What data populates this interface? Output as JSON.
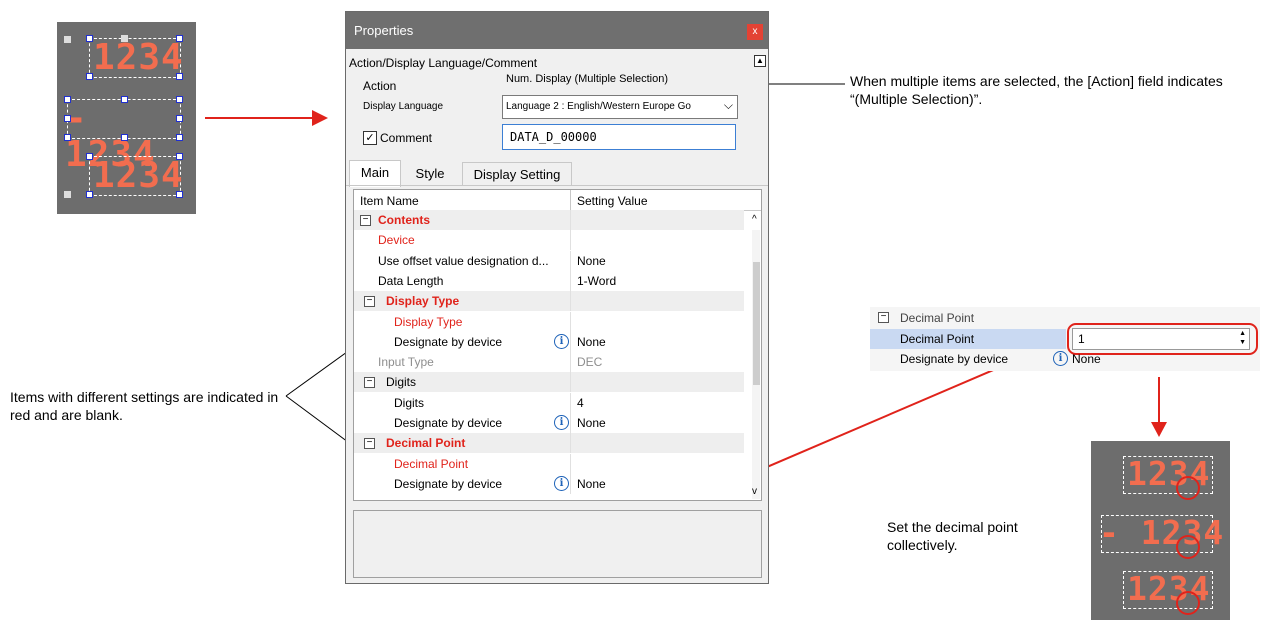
{
  "left_displays": [
    "1234",
    "- 1234",
    "1234"
  ],
  "dialog": {
    "title": "Properties",
    "close_label": "x",
    "section_header": "Action/Display Language/Comment",
    "collapse_icon": "▲",
    "action_label": "Action",
    "action_value": "Num. Display (Multiple Selection)",
    "display_language_label": "Display Language",
    "display_language_value": "Language 2 : English/Western Europe Go",
    "comment_label": "Comment",
    "comment_checked": true,
    "comment_value": "DATA_D_00000",
    "tabs": [
      "Main",
      "Style",
      "Display Setting"
    ],
    "active_tab": "Main",
    "columns": [
      "Item Name",
      "Setting Value"
    ],
    "rows": [
      {
        "name": "Contents",
        "value": "",
        "level": 0,
        "toggle": "−",
        "style": "red bold",
        "shade": true
      },
      {
        "name": "Device",
        "value": "",
        "level": 1,
        "toggle": "",
        "style": "red",
        "shade": false
      },
      {
        "name": "Use offset value designation d...",
        "value": "None",
        "level": 1,
        "toggle": "",
        "style": "",
        "shade": false
      },
      {
        "name": "Data Length",
        "value": "1-Word",
        "level": 1,
        "toggle": "",
        "style": "",
        "shade": false
      },
      {
        "name": "Display Type",
        "value": "",
        "level": 1,
        "toggle": "−",
        "style": "red bold",
        "shade": true
      },
      {
        "name": "Display Type",
        "value": "",
        "level": 2,
        "toggle": "",
        "style": "red",
        "shade": false
      },
      {
        "name": "Designate by device",
        "value": "None",
        "level": 2,
        "toggle": "",
        "style": "",
        "shade": false,
        "info": true
      },
      {
        "name": "Input Type",
        "value": "DEC",
        "level": 1,
        "toggle": "",
        "style": "gray",
        "shade": false
      },
      {
        "name": "Digits",
        "value": "",
        "level": 1,
        "toggle": "−",
        "style": "",
        "shade": true
      },
      {
        "name": "Digits",
        "value": "4",
        "level": 2,
        "toggle": "",
        "style": "",
        "shade": false
      },
      {
        "name": "Designate by device",
        "value": "None",
        "level": 2,
        "toggle": "",
        "style": "",
        "shade": false,
        "info": true
      },
      {
        "name": "Decimal Point",
        "value": "",
        "level": 1,
        "toggle": "−",
        "style": "red bold",
        "shade": true
      },
      {
        "name": "Decimal Point",
        "value": "",
        "level": 2,
        "toggle": "",
        "style": "red",
        "shade": false
      },
      {
        "name": "Designate by device",
        "value": "None",
        "level": 2,
        "toggle": "",
        "style": "",
        "shade": false,
        "info": true
      }
    ],
    "scroll_up_icon": "^",
    "scroll_down_icon": "v"
  },
  "annotations": {
    "multiple_selection": "When multiple items are selected, the [Action] field indicates “(Multiple Selection)”.",
    "different_settings": "Items with different settings are indicated in red and are blank.",
    "decimal_collective": "Set the decimal point collectively."
  },
  "snippet": {
    "group_label": "Decimal Point",
    "row1_name": "Decimal Point",
    "row1_value": "1",
    "row2_name": "Designate by device",
    "row2_value": "None"
  },
  "right_displays": [
    "1234",
    "- 1234",
    "1234"
  ],
  "colors": {
    "highlight_red": "#e0231b",
    "panel_gray": "#6d6d6d",
    "segment_orange": "#f26d4f",
    "selection_blue": "#c9d9f2"
  }
}
